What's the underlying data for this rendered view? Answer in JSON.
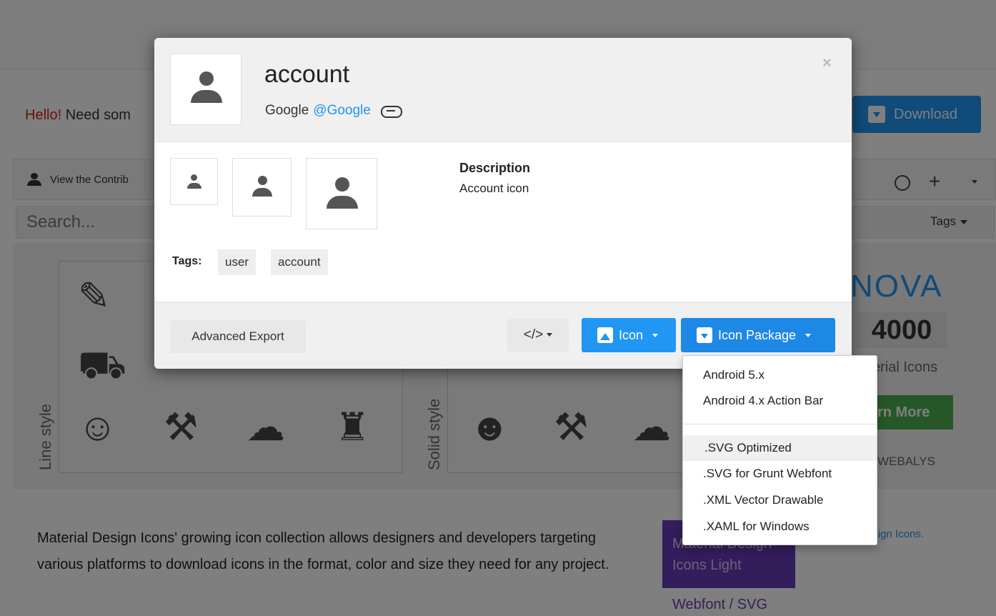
{
  "background": {
    "hello_red": "Hello!",
    "hello_text": " Need som",
    "download_label": "Download",
    "contributors_label": "View the Contrib",
    "search_placeholder": "Search...",
    "tags_dropdown_label": "Tags",
    "line_style_label": "Line style",
    "solid_style_label": "Solid style",
    "promo": {
      "nova": "NOVA",
      "count": "4000",
      "material_icons": "erial Icons",
      "learn_more": "rn More",
      "webalys": "WEBALYS"
    },
    "description_text": "Material Design Icons' growing icon collection allows designers and developers targeting various platforms to download icons in the format, color and size they need for any project.",
    "mdi_light_box": "Material Design Icons Light",
    "side_link": "of Material Design Icons.",
    "webfont_label": "Webfont / SVG"
  },
  "modal": {
    "title": "account",
    "author_name": "Google",
    "author_handle": "@Google",
    "close_symbol": "×",
    "description_label": "Description",
    "description_text": "Account icon",
    "tags_label": "Tags:",
    "tags": [
      "user",
      "account"
    ],
    "footer": {
      "advanced_export": "Advanced Export",
      "code_button": "</>",
      "icon_button": "Icon",
      "icon_package_button": "Icon Package"
    }
  },
  "dropdown": {
    "group1": [
      "Android 5.x",
      "Android 4.x Action Bar"
    ],
    "group2": [
      ".SVG Optimized",
      ".SVG for Grunt Webfont",
      ".XML Vector Drawable",
      ".XAML for Windows"
    ],
    "active_item": ".SVG Optimized"
  },
  "colors": {
    "primary_blue": "#2196f3",
    "overlay": "rgba(0,0,0,0.5)",
    "modal_header_bg": "#f0f0f0",
    "success_green": "#4caf50",
    "brand_purple": "#673ab7"
  },
  "icons": {
    "main": "account-icon",
    "link": "link-icon",
    "image": "image-icon",
    "package": "package-down-icon",
    "code": "code-tags-icon"
  }
}
